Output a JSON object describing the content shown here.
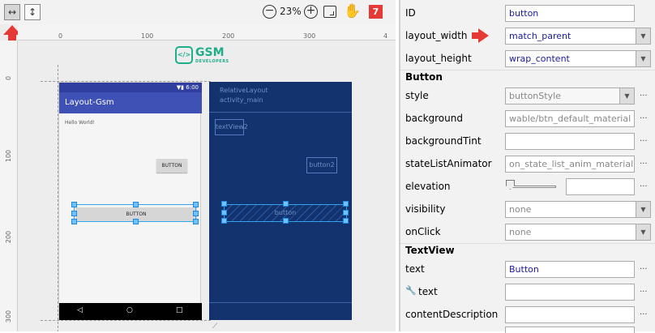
{
  "toolbar": {
    "zoom": "23%",
    "error_count": "7"
  },
  "rulers": {
    "top": [
      "0",
      "100",
      "200",
      "300",
      "4"
    ],
    "left": [
      "0",
      "100",
      "200",
      "300"
    ]
  },
  "logo": {
    "text": "GSM",
    "subtext": "DEVELOPERS"
  },
  "design": {
    "status_time": "6:00",
    "app_title": "Layout-Gsm",
    "hello": "Hello World!",
    "button2_label": "BUTTON",
    "button1_label": "BUTTON",
    "nav_back": "◁",
    "nav_home": "○",
    "nav_recent": "□"
  },
  "blueprint": {
    "layout_type": "RelativeLayout",
    "layout_id": "activity_main",
    "textview_label": "textView2",
    "button2_label": "button2",
    "button_label": "button"
  },
  "props": {
    "id_label": "ID",
    "id_value": "button",
    "layout_width_label": "layout_width",
    "layout_width_value": "match_parent",
    "layout_height_label": "layout_height",
    "layout_height_value": "wrap_content",
    "section_button": "Button",
    "style_label": "style",
    "style_value": "buttonStyle",
    "background_label": "background",
    "background_value": "wable/btn_default_material",
    "backgroundTint_label": "backgroundTint",
    "backgroundTint_value": "",
    "stateListAnimator_label": "stateListAnimator",
    "stateListAnimator_value": "on_state_list_anim_material",
    "elevation_label": "elevation",
    "elevation_value": "",
    "visibility_label": "visibility",
    "visibility_value": "none",
    "onClick_label": "onClick",
    "onClick_value": "none",
    "section_textview": "TextView",
    "text_label": "text",
    "text_value": "Button",
    "tools_text_label": "text",
    "tools_text_value": "",
    "contentDescription_label": "contentDescription",
    "contentDescription_value": "",
    "dots": "..."
  },
  "colors": {
    "accent_red": "#e53935",
    "blueprint_bg": "#12336e",
    "appbar": "#3f51b5"
  }
}
